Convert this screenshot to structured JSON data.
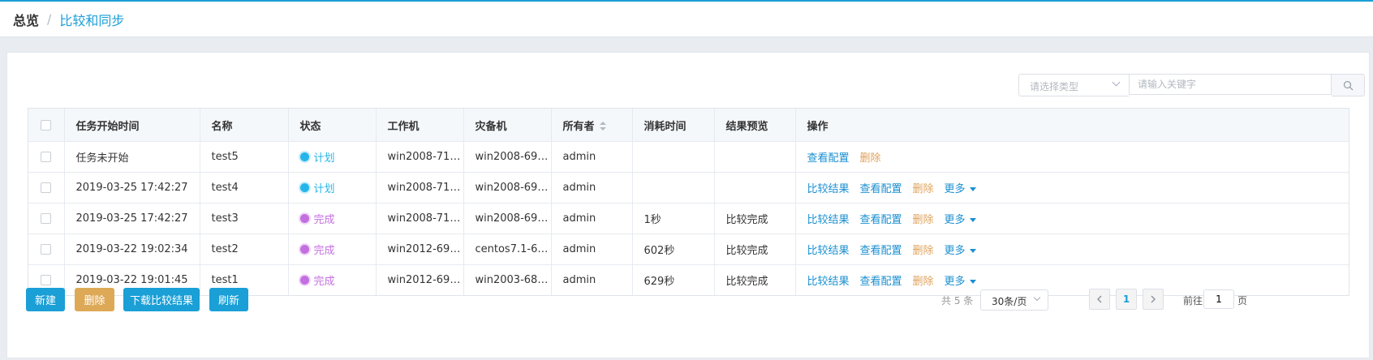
{
  "breadcrumb": {
    "home": "总览",
    "separator": "/",
    "current": "比较和同步"
  },
  "filter": {
    "type_placeholder": "请选择类型",
    "keyword_placeholder": "请输入关键字",
    "search_icon": "search-icon"
  },
  "table": {
    "columns": [
      "任务开始时间",
      "名称",
      "状态",
      "工作机",
      "灾备机",
      "所有者",
      "消耗时间",
      "结果预览",
      "操作"
    ],
    "rows": [
      {
        "start_time": "任务未开始",
        "name": "test5",
        "status": "计划",
        "status_kind": "plan",
        "worker": "win2008-71.1...",
        "backup": "win2008-69.1...",
        "owner": "admin",
        "duration": "",
        "preview": "",
        "ops": {
          "view": "查看配置",
          "delete": "删除"
        }
      },
      {
        "start_time": "2019-03-25 17:42:27",
        "name": "test4",
        "status": "计划",
        "status_kind": "plan",
        "worker": "win2008-71.1...",
        "backup": "win2008-69.1...",
        "owner": "admin",
        "duration": "",
        "preview": "",
        "ops": {
          "compare": "比较结果",
          "view": "查看配置",
          "delete": "删除",
          "more": "更多"
        }
      },
      {
        "start_time": "2019-03-25 17:42:27",
        "name": "test3",
        "status": "完成",
        "status_kind": "done",
        "worker": "win2008-71.1...",
        "backup": "win2008-69.1...",
        "owner": "admin",
        "duration": "1秒",
        "preview": "比较完成",
        "ops": {
          "compare": "比较结果",
          "view": "查看配置",
          "delete": "删除",
          "more": "更多"
        }
      },
      {
        "start_time": "2019-03-22 19:02:34",
        "name": "test2",
        "status": "完成",
        "status_kind": "done",
        "worker": "win2012-69.1...",
        "backup": "centos7.1-66....",
        "owner": "admin",
        "duration": "602秒",
        "preview": "比较完成",
        "ops": {
          "compare": "比较结果",
          "view": "查看配置",
          "delete": "删除",
          "more": "更多"
        }
      },
      {
        "start_time": "2019-03-22 19:01:45",
        "name": "test1",
        "status": "完成",
        "status_kind": "done",
        "worker": "win2012-69.1...",
        "backup": "win2003-68.2...",
        "owner": "admin",
        "duration": "629秒",
        "preview": "比较完成",
        "ops": {
          "compare": "比较结果",
          "view": "查看配置",
          "delete": "删除",
          "more": "更多"
        }
      }
    ]
  },
  "actions": {
    "new": "新建",
    "delete": "删除",
    "download": "下载比较结果",
    "refresh": "刷新"
  },
  "pagination": {
    "total": "共 5 条",
    "page_size": "30条/页",
    "current_page": "1",
    "goto_label": "前往",
    "goto_value": "1",
    "page_suffix": "页"
  },
  "colors": {
    "accent": "#1a9fd6",
    "plan": "#26b5ea",
    "done": "#c46fe0",
    "delete": "#e0a25a",
    "delete_button": "#dda957"
  }
}
